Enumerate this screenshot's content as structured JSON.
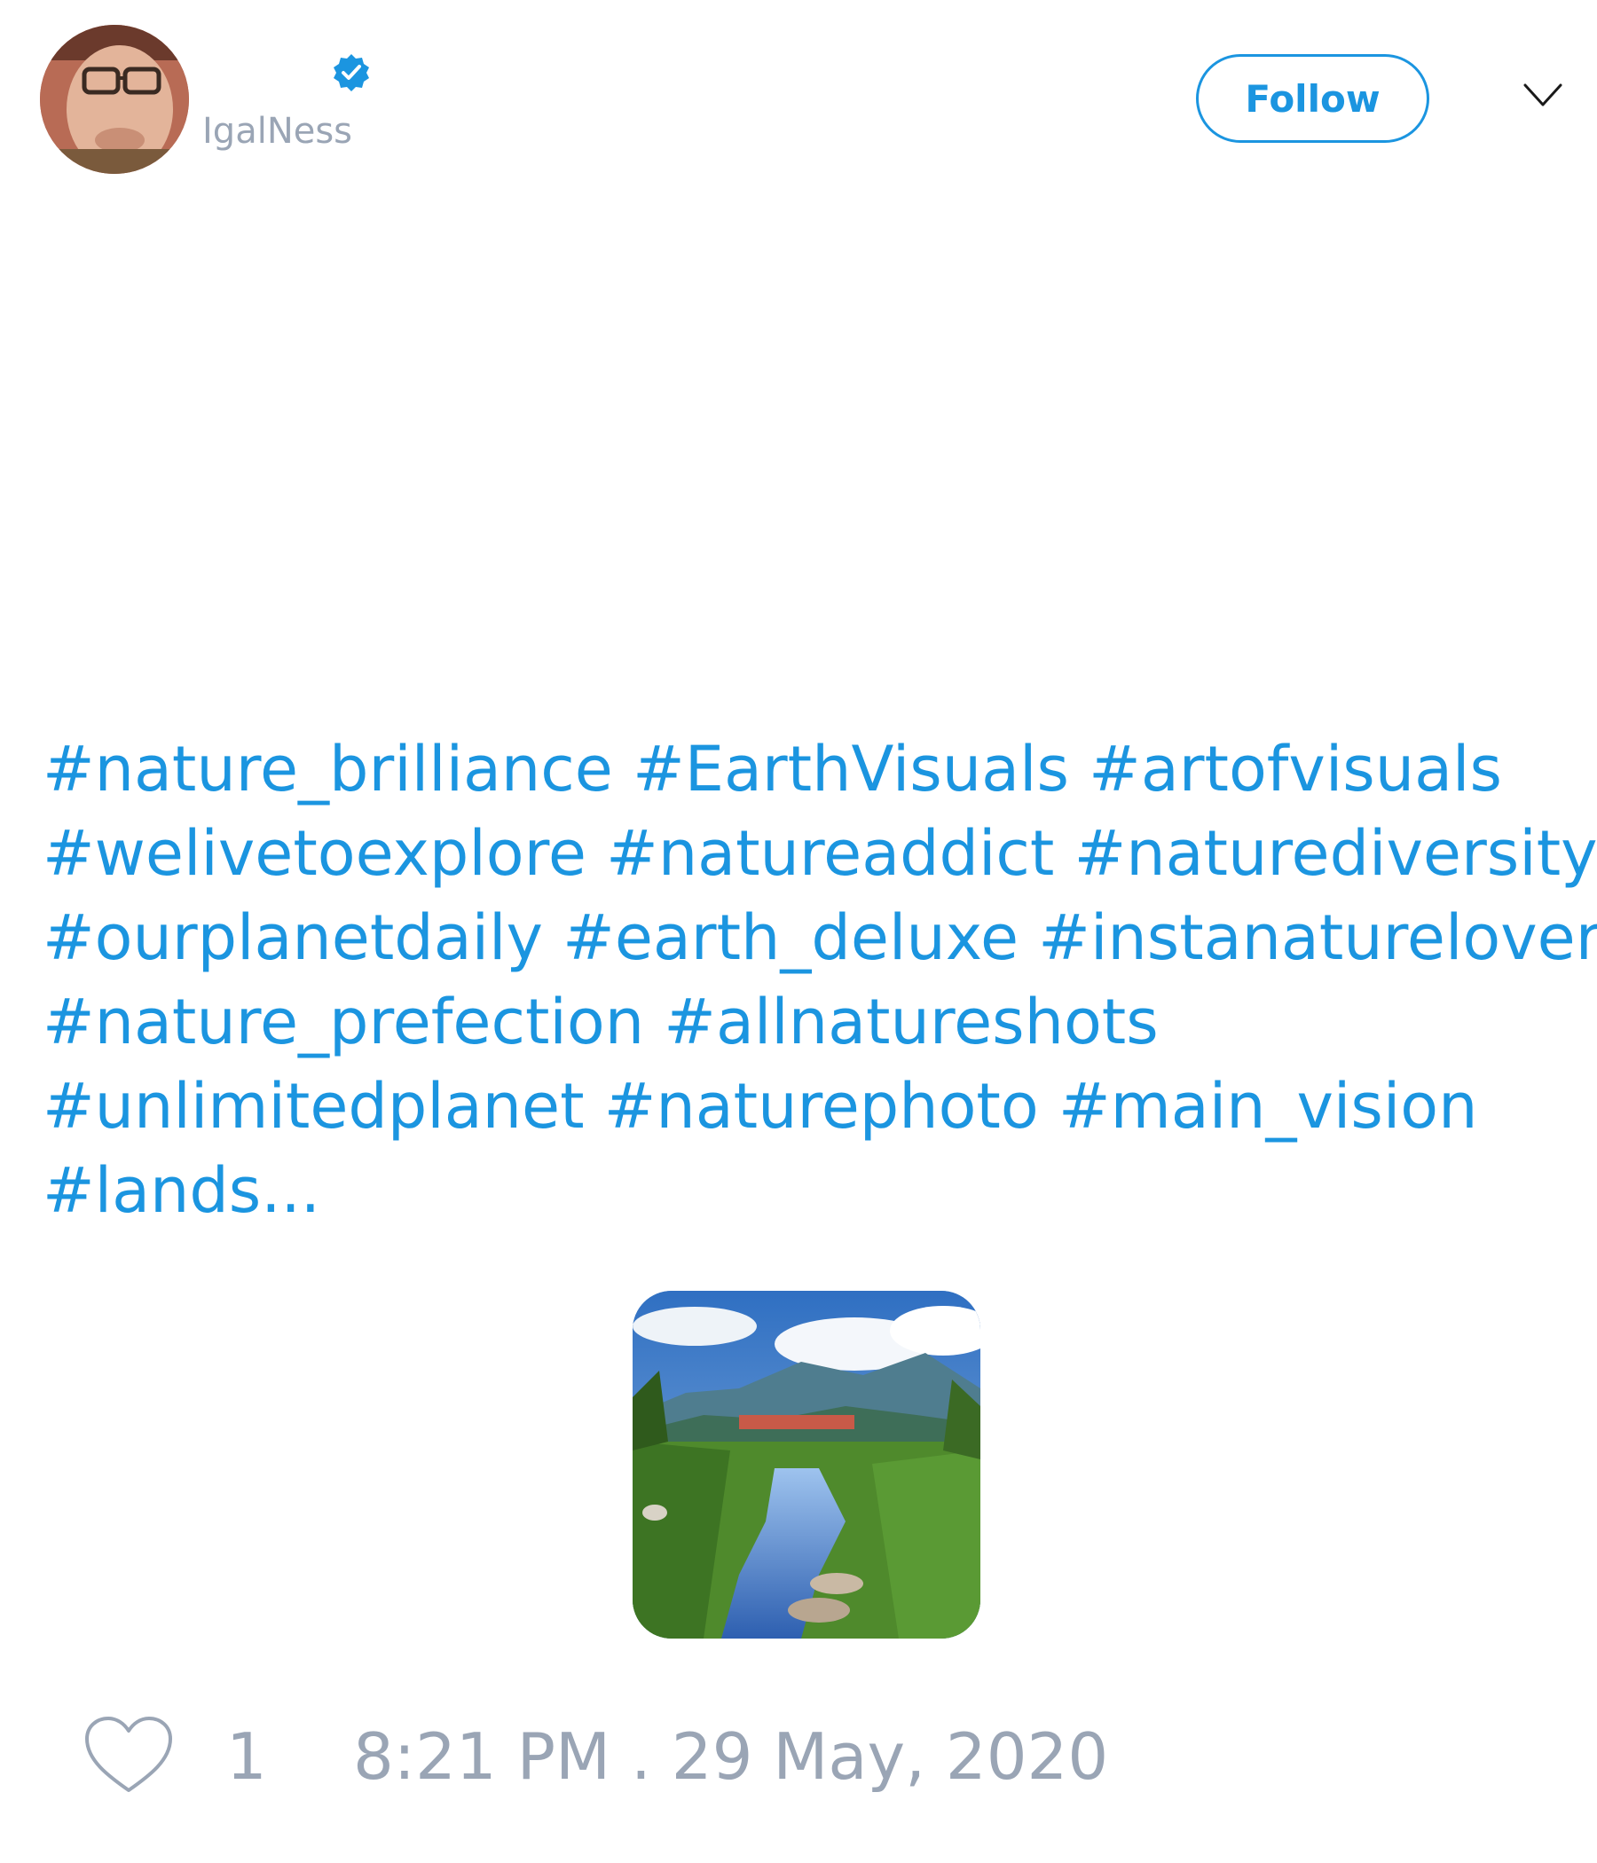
{
  "author": {
    "handle": "IgalNess",
    "verified": true
  },
  "actions": {
    "follow_label": "Follow"
  },
  "tweet": {
    "text_lines": [
      "#nature_brilliance #EarthVisuals #artofvisuals",
      "#welivetoexplore #natureaddict #naturediversity",
      "#ourplanetdaily #earth_deluxe #instanaturelover",
      "#nature_prefection #allnatureshots",
      "#unlimitedplanet #naturephoto #main_vision",
      "#lands..."
    ]
  },
  "footer": {
    "like_count": "1",
    "timestamp": "8:21 PM . 29 May, 2020"
  },
  "icons": {
    "like": "heart-icon",
    "menu": "chevron-down-icon",
    "verified": "verified-badge-icon"
  },
  "colors": {
    "accent": "#1b95e0",
    "muted": "#9aa5b5",
    "background": "#ffffff"
  }
}
